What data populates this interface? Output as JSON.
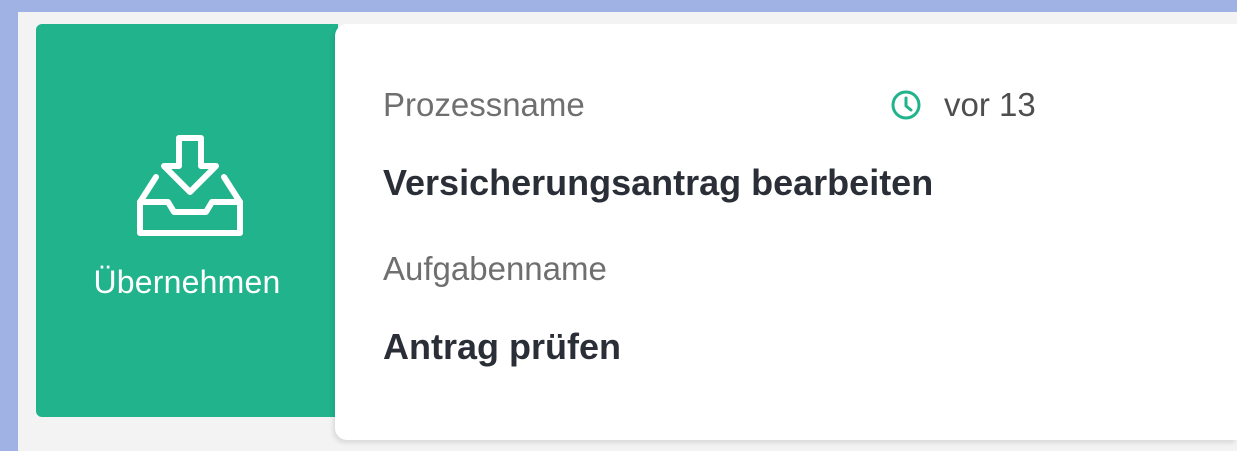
{
  "colors": {
    "background": "#9fb2e3",
    "accent": "#20b38c",
    "card": "#ffffff",
    "panel": "#f3f3f3"
  },
  "task_card": {
    "action": {
      "icon": "inbox-download-icon",
      "label": "Übernehmen"
    },
    "process": {
      "label": "Prozessname",
      "value": "Versicherungsantrag bearbeiten"
    },
    "timestamp": {
      "icon": "clock-icon",
      "text": "vor 13"
    },
    "task": {
      "label": "Aufgabenname",
      "value": "Antrag prüfen"
    }
  }
}
